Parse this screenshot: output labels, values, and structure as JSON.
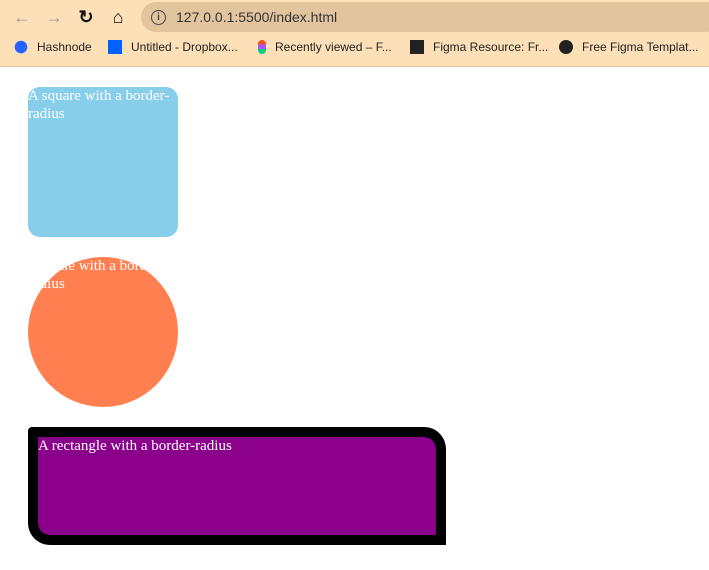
{
  "browser": {
    "url": "127.0.0.1:5500/index.html",
    "bookmarks": [
      {
        "label": "Hashnode",
        "icon": "hashnode-icon",
        "color": "#2962ff"
      },
      {
        "label": "Untitled - Dropbox...",
        "icon": "dropbox-icon",
        "color": "#0061fe"
      },
      {
        "label": "Recently viewed – F...",
        "icon": "figma-icon"
      },
      {
        "label": "Figma Resource: Fr...",
        "icon": "figma-resource-icon"
      },
      {
        "label": "Free Figma Templat...",
        "icon": "globe-icon"
      }
    ]
  },
  "page": {
    "square": {
      "text": "A square with a border-radius",
      "color": "#87ceeb"
    },
    "circle": {
      "text": "A circle with a border-radius",
      "color": "#ff7f50"
    },
    "rectangle": {
      "text": "A rectangle with a border-radius",
      "color": "#8b008b"
    }
  }
}
